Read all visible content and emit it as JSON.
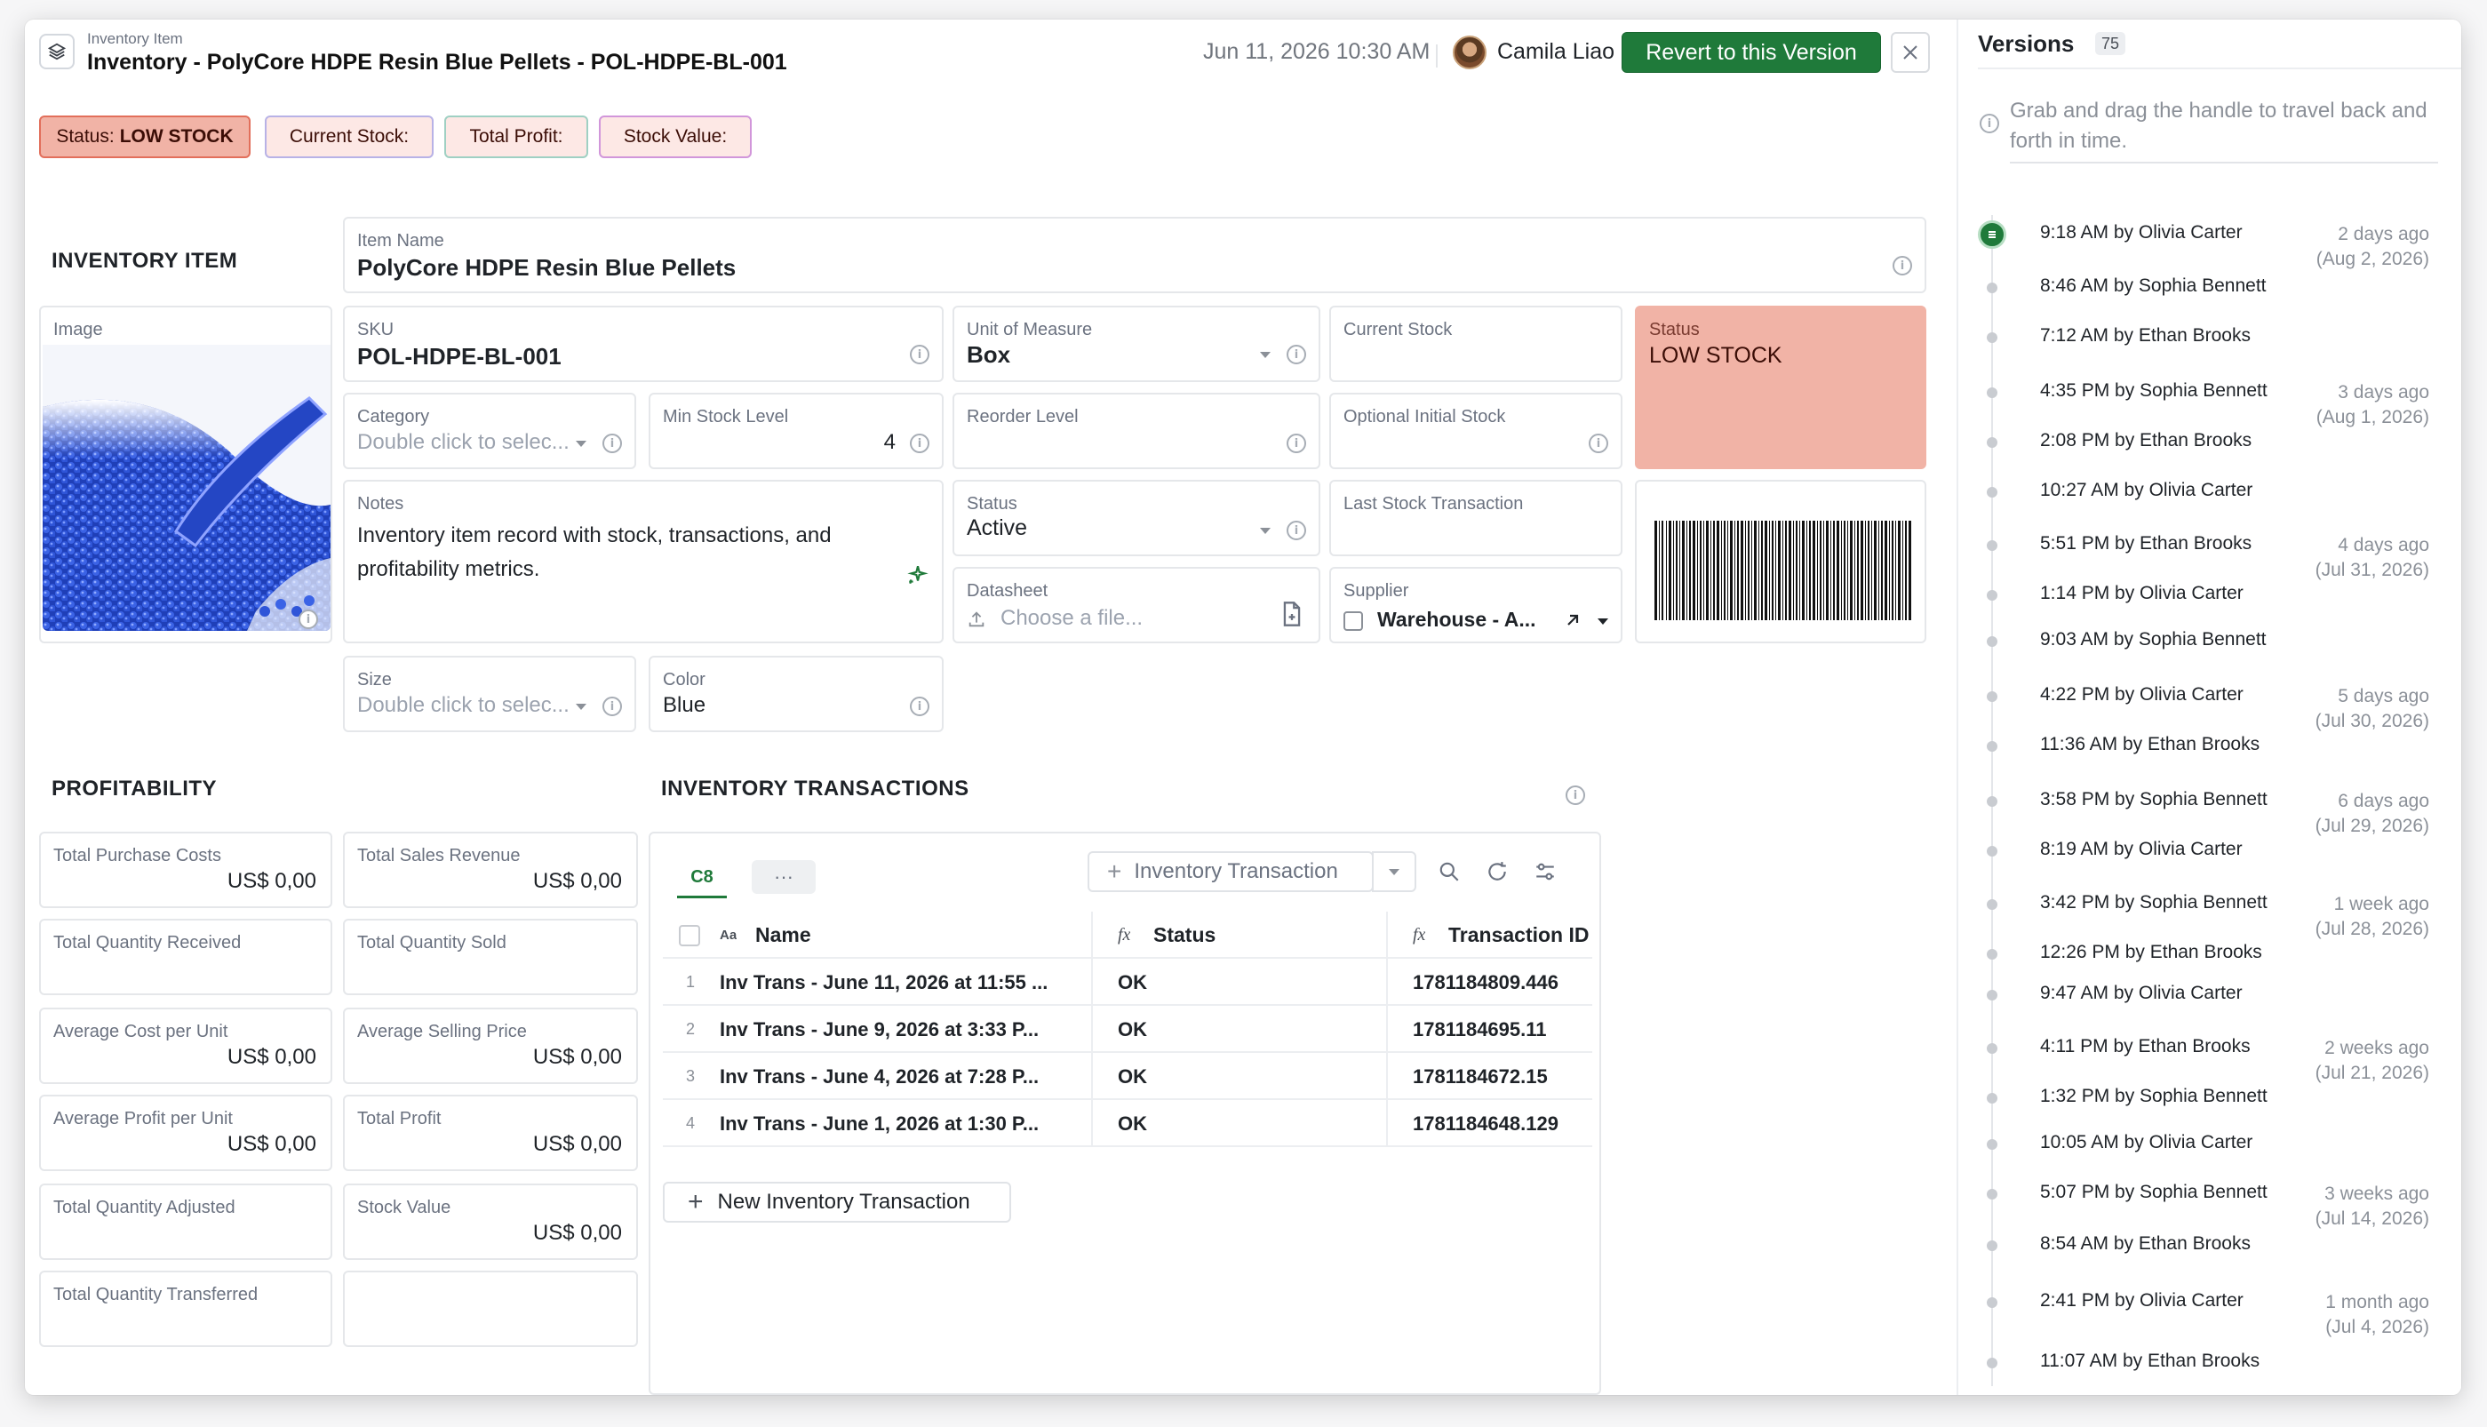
{
  "header": {
    "kicker": "Inventory Item",
    "title": "Inventory - PolyCore HDPE Resin Blue Pellets - POL-HDPE-BL-001",
    "date": "Jun 11, 2026 10:30 AM",
    "user": "Camila Liao",
    "revert_label": "Revert to this Version"
  },
  "badges": {
    "status_prefix": "Status:",
    "status_value": "LOW STOCK",
    "current_stock": "Current Stock:",
    "total_profit": "Total Profit:",
    "stock_value": "Stock Value:"
  },
  "inventory_item": {
    "heading": "INVENTORY ITEM",
    "image_label": "Image",
    "item_name": {
      "label": "Item Name",
      "value": "PolyCore HDPE Resin Blue Pellets"
    },
    "sku": {
      "label": "SKU",
      "value": "POL-HDPE-BL-001"
    },
    "unit": {
      "label": "Unit of Measure",
      "value": "Box"
    },
    "current_stock": {
      "label": "Current Stock",
      "value": ""
    },
    "status_box": {
      "label": "Status",
      "value": "LOW STOCK"
    },
    "category": {
      "label": "Category",
      "placeholder": "Double click to selec..."
    },
    "min_stock": {
      "label": "Min Stock Level",
      "value": "4"
    },
    "reorder": {
      "label": "Reorder Level",
      "value": ""
    },
    "initial_stock": {
      "label": "Optional Initial Stock",
      "value": ""
    },
    "notes": {
      "label": "Notes",
      "value": "Inventory item record with stock, transactions, and profitability metrics."
    },
    "status": {
      "label": "Status",
      "value": "Active"
    },
    "last_tx": {
      "label": "Last Stock Transaction",
      "value": ""
    },
    "datasheet": {
      "label": "Datasheet",
      "placeholder": "Choose a file..."
    },
    "supplier": {
      "label": "Supplier",
      "value": "Warehouse - A..."
    },
    "size": {
      "label": "Size",
      "placeholder": "Double click to selec..."
    },
    "color": {
      "label": "Color",
      "value": "Blue"
    }
  },
  "profitability": {
    "heading": "PROFITABILITY",
    "fields": [
      {
        "label": "Total Purchase Costs",
        "value": "US$ 0,00"
      },
      {
        "label": "Total Sales Revenue",
        "value": "US$ 0,00"
      },
      {
        "label": "Total Quantity Received",
        "value": ""
      },
      {
        "label": "Total Quantity Sold",
        "value": ""
      },
      {
        "label": "Average Cost per Unit",
        "value": "US$ 0,00"
      },
      {
        "label": "Average Selling Price",
        "value": "US$ 0,00"
      },
      {
        "label": "Average Profit per Unit",
        "value": "US$ 0,00"
      },
      {
        "label": "Total Profit",
        "value": "US$ 0,00"
      },
      {
        "label": "Total Quantity Adjusted",
        "value": ""
      },
      {
        "label": "Stock Value",
        "value": "US$ 0,00"
      },
      {
        "label": "Total Quantity Transferred",
        "value": ""
      },
      {
        "label": "",
        "value": ""
      }
    ]
  },
  "transactions": {
    "heading": "INVENTORY TRANSACTIONS",
    "tab": "C8",
    "tab_more": "···",
    "add_label": "Inventory Transaction",
    "columns": {
      "name": "Name",
      "status": "Status",
      "id": "Transaction ID",
      "name_icon": "Aa",
      "formula_icon": "fx"
    },
    "rows": [
      {
        "n": "1",
        "name": "Inv Trans - June 11, 2026 at 11:55 ...",
        "status": "OK",
        "id": "1781184809.446"
      },
      {
        "n": "2",
        "name": "Inv Trans - June 9, 2026 at 3:33 P...",
        "status": "OK",
        "id": "1781184695.11"
      },
      {
        "n": "3",
        "name": "Inv Trans - June 4, 2026 at 7:28 P...",
        "status": "OK",
        "id": "1781184672.15"
      },
      {
        "n": "4",
        "name": "Inv Trans - June 1, 2026 at 1:30 P...",
        "status": "OK",
        "id": "1781184648.129"
      }
    ],
    "new_label": "New Inventory Transaction"
  },
  "versions": {
    "title": "Versions",
    "count": "75",
    "hint": "Grab and drag the handle to travel back and forth in time.",
    "items": [
      {
        "t": "9:18 AM by Olivia Carter",
        "ago": "2 days ago",
        "date": "(Aug 2, 2026)"
      },
      {
        "t": "8:46 AM by Sophia Bennett",
        "ago": "",
        "date": ""
      },
      {
        "t": "7:12 AM by Ethan Brooks",
        "ago": "",
        "date": ""
      },
      {
        "t": "4:35 PM by Sophia Bennett",
        "ago": "3 days ago",
        "date": "(Aug 1, 2026)"
      },
      {
        "t": "2:08 PM by Ethan Brooks",
        "ago": "",
        "date": ""
      },
      {
        "t": "10:27 AM by Olivia Carter",
        "ago": "",
        "date": ""
      },
      {
        "t": "5:51 PM by Ethan Brooks",
        "ago": "4 days ago",
        "date": "(Jul 31, 2026)"
      },
      {
        "t": "1:14 PM by Olivia Carter",
        "ago": "",
        "date": ""
      },
      {
        "t": "9:03 AM by Sophia Bennett",
        "ago": "",
        "date": ""
      },
      {
        "t": "4:22 PM by Olivia Carter",
        "ago": "5 days ago",
        "date": "(Jul 30, 2026)"
      },
      {
        "t": "11:36 AM by Ethan Brooks",
        "ago": "",
        "date": ""
      },
      {
        "t": "3:58 PM by Sophia Bennett",
        "ago": "6 days ago",
        "date": "(Jul 29, 2026)"
      },
      {
        "t": "8:19 AM by Olivia Carter",
        "ago": "",
        "date": ""
      },
      {
        "t": "3:42 PM by Sophia Bennett",
        "ago": "1 week ago",
        "date": "(Jul 28, 2026)"
      },
      {
        "t": "12:26 PM by Ethan Brooks",
        "ago": "",
        "date": ""
      },
      {
        "t": "9:47 AM by Olivia Carter",
        "ago": "",
        "date": ""
      },
      {
        "t": "4:11 PM by Ethan Brooks",
        "ago": "2 weeks ago",
        "date": "(Jul 21, 2026)"
      },
      {
        "t": "1:32 PM by Sophia Bennett",
        "ago": "",
        "date": ""
      },
      {
        "t": "10:05 AM by Olivia Carter",
        "ago": "",
        "date": ""
      },
      {
        "t": "5:07 PM by Sophia Bennett",
        "ago": "3 weeks ago",
        "date": "(Jul 14, 2026)"
      },
      {
        "t": "8:54 AM by Ethan Brooks",
        "ago": "",
        "date": ""
      },
      {
        "t": "2:41 PM by Olivia Carter",
        "ago": "1 month ago",
        "date": "(Jul 4, 2026)"
      },
      {
        "t": "11:07 AM by Ethan Brooks",
        "ago": "",
        "date": ""
      }
    ]
  },
  "colors": {
    "accent_green": "#1f7a3a",
    "status_low": "#f1b3a6",
    "status_border": "#e26f5b"
  }
}
